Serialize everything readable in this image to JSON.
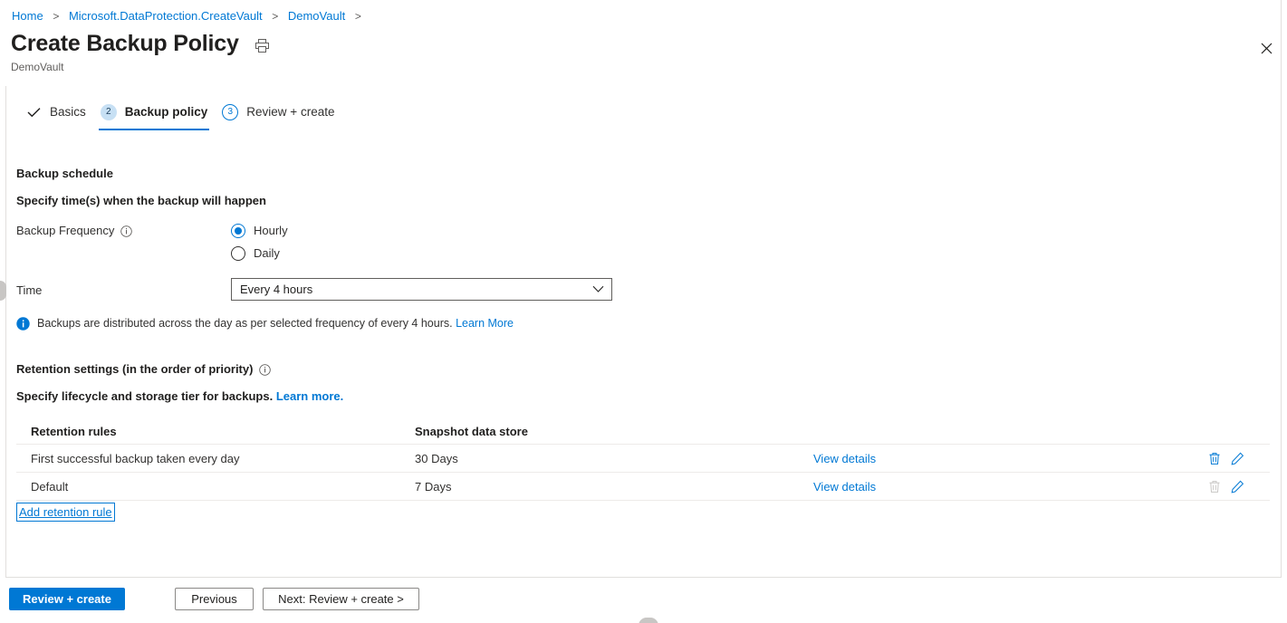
{
  "breadcrumb": {
    "items": [
      {
        "label": "Home"
      },
      {
        "label": "Microsoft.DataProtection.CreateVault"
      },
      {
        "label": "DemoVault"
      }
    ],
    "separator": ">"
  },
  "header": {
    "title": "Create Backup Policy",
    "subtitle": "DemoVault",
    "print_icon": "printer-icon",
    "close_icon": "close-icon"
  },
  "wizard": {
    "tabs": [
      {
        "badge": "✓",
        "badge_type": "check",
        "label": "Basics",
        "active": false
      },
      {
        "badge": "2",
        "badge_type": "filled",
        "label": "Backup policy",
        "active": true
      },
      {
        "badge": "3",
        "badge_type": "outline",
        "label": "Review + create",
        "active": false
      }
    ]
  },
  "schedule": {
    "section_title": "Backup schedule",
    "section_subtitle": "Specify time(s) when the backup will happen",
    "frequency_label": "Backup Frequency",
    "frequency_info_icon": "info-outline-icon",
    "frequency_options": [
      {
        "label": "Hourly",
        "selected": true
      },
      {
        "label": "Daily",
        "selected": false
      }
    ],
    "time_label": "Time",
    "time_value": "Every 4 hours",
    "time_chevron_icon": "chevron-down-icon",
    "info_icon": "info-filled-icon",
    "info_text": "Backups are distributed across the day as per selected frequency of every 4 hours.",
    "info_link": "Learn More"
  },
  "retention": {
    "section_title": "Retention settings (in the order of priority)",
    "section_info_icon": "info-outline-icon",
    "section_subtitle": "Specify lifecycle and storage tier for backups.",
    "section_subtitle_link": "Learn more.",
    "columns": [
      "Retention rules",
      "Snapshot data store"
    ],
    "rows": [
      {
        "rule": "First successful backup taken every day",
        "store": "30 Days",
        "link": "View details",
        "delete_icon": "trash-icon",
        "delete_enabled": true,
        "edit_icon": "pencil-icon",
        "edit_enabled": true
      },
      {
        "rule": "Default",
        "store": "7 Days",
        "link": "View details",
        "delete_icon": "trash-icon",
        "delete_enabled": false,
        "edit_icon": "pencil-icon",
        "edit_enabled": true
      }
    ],
    "add_rule_label": "Add retention rule"
  },
  "footer": {
    "review_create": "Review + create",
    "previous": "Previous",
    "next": "Next: Review + create >"
  },
  "colors": {
    "accent": "#0078d4",
    "link": "#0078d4",
    "text": "#201f1e",
    "muted": "#605e5c",
    "border": "#e1dfdd",
    "disabled_icon": "#a19f9d",
    "badge_fill": "#c7e0f4"
  }
}
